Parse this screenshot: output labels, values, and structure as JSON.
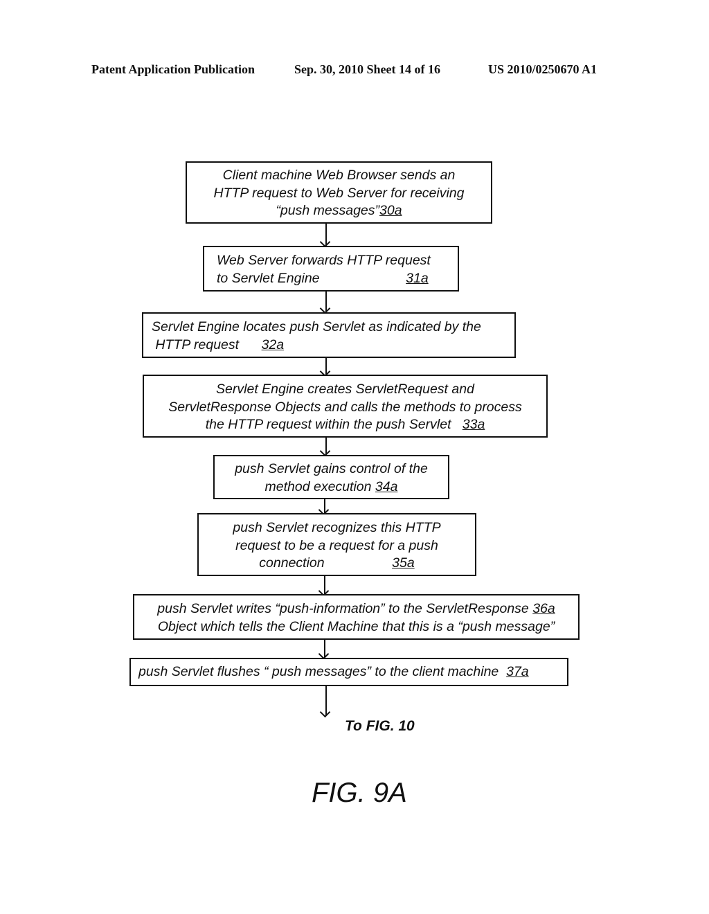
{
  "header": {
    "publication": "Patent Application Publication",
    "date_sheet": "Sep. 30, 2010   Sheet 14 of 16",
    "patent_number": "US 2010/0250670 A1"
  },
  "flowchart": {
    "steps": [
      {
        "lines": [
          "Client machine Web Browser sends an",
          "HTTP request to Web Server for receiving",
          "“push messages”"
        ],
        "ref": "30a"
      },
      {
        "lines": [
          "Web Server forwards HTTP request",
          "to Servlet Engine                       "
        ],
        "ref": "31a"
      },
      {
        "lines": [
          "Servlet Engine locates push Servlet as indicated by the",
          " HTTP request      "
        ],
        "ref": "32a"
      },
      {
        "lines": [
          "Servlet Engine creates ServletRequest and",
          "ServletResponse Objects and calls the methods to process",
          "the HTTP request within the push Servlet   "
        ],
        "ref": "33a"
      },
      {
        "lines": [
          "push Servlet gains control of the",
          "method execution "
        ],
        "ref": "34a"
      },
      {
        "lines": [
          "push Servlet recognizes this HTTP",
          "request to be a request for a push",
          "connection                  "
        ],
        "ref": "35a"
      },
      {
        "lines": [
          "push Servlet writes “push-information” to the ServletResponse ",
          "Object which tells the Client Machine that this is a “push message”"
        ],
        "ref": "36a",
        "ref_line": 0
      },
      {
        "lines": [
          "push Servlet flushes “ push messages” to the client machine  "
        ],
        "ref": "37a"
      }
    ],
    "continuation": "To FIG. 10"
  },
  "figure_label": "FIG. 9A"
}
